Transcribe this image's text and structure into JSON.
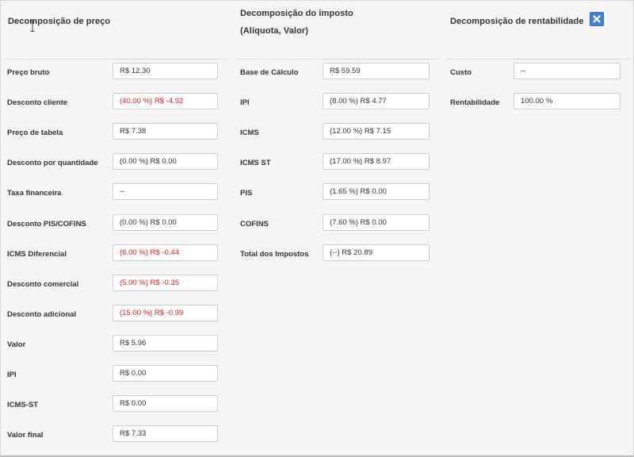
{
  "price": {
    "title": "Decomposição de preço",
    "rows": [
      {
        "label": "Preço bruto",
        "value": "R$ 12.30",
        "negative": false
      },
      {
        "label": "Desconto cliente",
        "value": "(40.00 %) R$ -4.92",
        "negative": true
      },
      {
        "label": "Preço de tabela",
        "value": "R$ 7.38",
        "negative": false
      },
      {
        "label": "Desconto por quantidade",
        "value": "(0.00 %) R$ 0.00",
        "negative": false
      },
      {
        "label": "Taxa financeira",
        "value": "--",
        "negative": false
      },
      {
        "label": "Desconto PIS/COFINS",
        "value": "(0.00 %) R$ 0.00",
        "negative": false
      },
      {
        "label": "ICMS Diferencial",
        "value": "(6.00 %) R$ -0.44",
        "negative": true
      },
      {
        "label": "Desconto comercial",
        "value": "(5.00 %) R$ -0.35",
        "negative": true
      },
      {
        "label": "Desconto adicional",
        "value": "(15.00 %) R$ -0.99",
        "negative": true
      },
      {
        "label": "Valor",
        "value": "R$ 5.96",
        "negative": false
      },
      {
        "label": "IPI",
        "value": "R$ 0.00",
        "negative": false
      },
      {
        "label": "ICMS-ST",
        "value": "R$ 0.00",
        "negative": false
      },
      {
        "label": "Valor final",
        "value": "R$ 7.33",
        "negative": false
      }
    ]
  },
  "tax": {
    "title": "Decomposição do imposto",
    "subtitle": "(Alíquota, Valor)",
    "rows": [
      {
        "label": "Base de Cálculo",
        "value": "R$ 59.59",
        "negative": false
      },
      {
        "label": "IPI",
        "value": "(8.00 %)  R$ 4.77",
        "negative": false
      },
      {
        "label": "ICMS",
        "value": "(12.00 %)  R$ 7.15",
        "negative": false
      },
      {
        "label": "ICMS ST",
        "value": "(17.00 %)  R$ 8.97",
        "negative": false
      },
      {
        "label": "PIS",
        "value": "(1.65 %)  R$ 0.00",
        "negative": false
      },
      {
        "label": "COFINS",
        "value": "(7.60 %)  R$ 0.00",
        "negative": false
      },
      {
        "label": "Total dos Impostos",
        "value": "(--) R$ 20.89",
        "negative": false
      }
    ]
  },
  "rent": {
    "title": "Decomposição de rentabilidade",
    "rows": [
      {
        "label": "Custo",
        "value": "--",
        "negative": false
      },
      {
        "label": "Rentabilidade",
        "value": "100.00 %",
        "negative": false
      }
    ]
  },
  "colors": {
    "negative": "#e02020",
    "close_button": "#3f82d6"
  },
  "icons": {
    "close": "close-icon"
  }
}
